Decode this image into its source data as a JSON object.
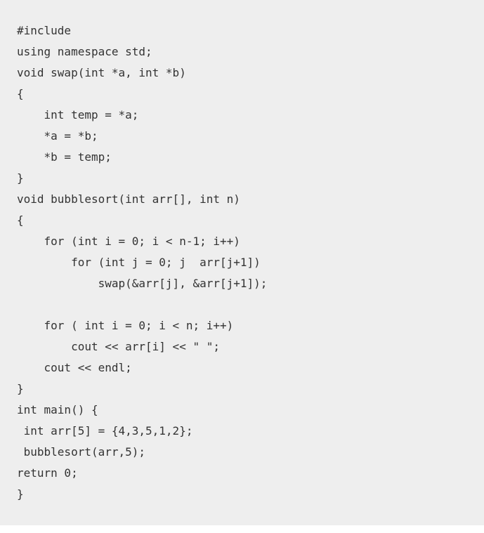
{
  "code": {
    "lines": [
      "#include",
      "using namespace std;",
      "void swap(int *a, int *b)",
      "{",
      "    int temp = *a;",
      "    *a = *b;",
      "    *b = temp;",
      "}",
      "void bubblesort(int arr[], int n)",
      "{",
      "    for (int i = 0; i < n-1; i++)",
      "        for (int j = 0; j  arr[j+1])",
      "            swap(&arr[j], &arr[j+1]);",
      "",
      "    for ( int i = 0; i < n; i++)",
      "        cout << arr[i] << \" \";",
      "    cout << endl;",
      "}",
      "int main() {",
      " int arr[5] = {4,3,5,1,2};",
      " bubblesort(arr,5);",
      "return 0;",
      "}"
    ]
  }
}
